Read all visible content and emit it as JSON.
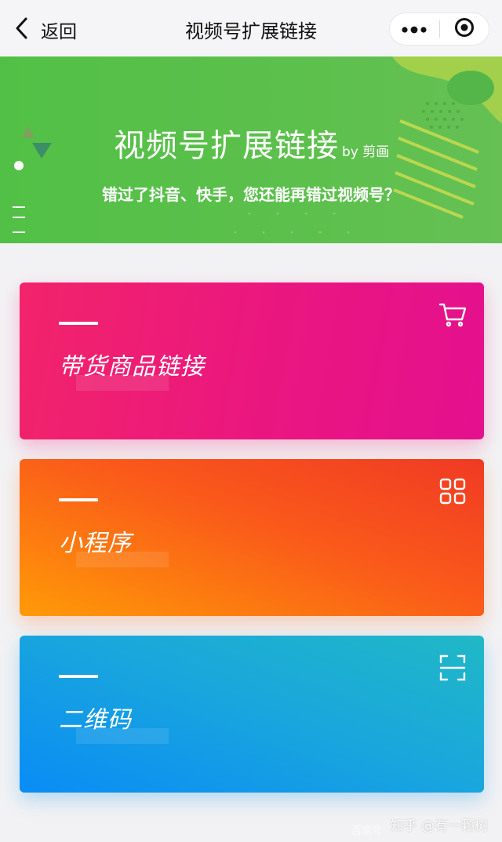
{
  "navbar": {
    "back_label": "返回",
    "title": "视频号扩展链接",
    "back_icon": "chevron-left-icon",
    "more_icon": "more-dots-icon",
    "close_icon": "target-circle-icon"
  },
  "banner": {
    "title": "视频号扩展链接",
    "by": "by 剪画",
    "subtitle": "错过了抖音、快手，您还能再错过视频号？",
    "color": "#55c048"
  },
  "cards": [
    {
      "label": "带货商品链接",
      "icon": "shopping-cart-icon",
      "color": "#ee1a7c"
    },
    {
      "label": "小程序",
      "icon": "grid-apps-icon",
      "color": "#f86020"
    },
    {
      "label": "二维码",
      "icon": "scan-frame-icon",
      "color": "#129fe2"
    }
  ],
  "watermark": {
    "text": "知乎 @有一颗树",
    "faint": "百家号"
  }
}
